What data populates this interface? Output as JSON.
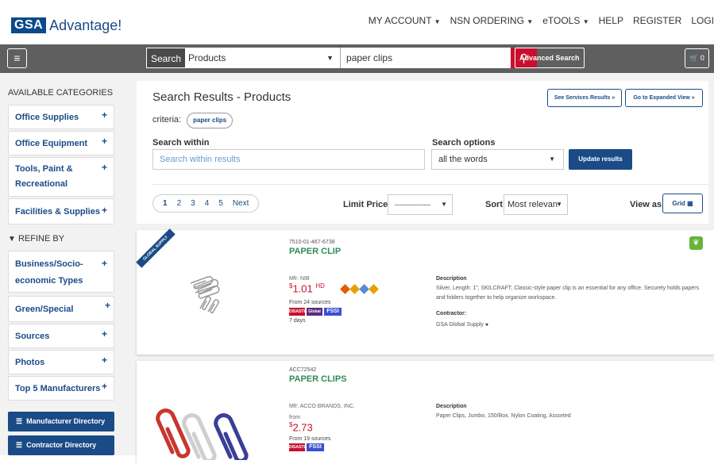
{
  "header": {
    "logo_gsa": "GSA",
    "logo_text": "Advantage!",
    "nav": [
      "MY ACCOUNT",
      "NSN ORDERING",
      "eTOOLS",
      "HELP",
      "REGISTER",
      "LOGI"
    ]
  },
  "search": {
    "label": "Search",
    "category": "Products",
    "query": "paper clips",
    "advanced": "Advanced Search",
    "cart_count": "0"
  },
  "sidebar": {
    "categories_header": "AVAILABLE CATEGORIES",
    "categories": [
      "Office Supplies",
      "Office Equipment",
      "Tools, Paint &",
      "Recreational",
      "Facilities & Supplies"
    ],
    "refine_header": "REFINE BY",
    "refine": [
      "Business/Socio-",
      "economic Types",
      "Green/Special Programs",
      "Sources",
      "Photos",
      "Top 5 Manufacturers"
    ],
    "dir_buttons": [
      "Manufacturer Directory",
      "Contractor Directory"
    ]
  },
  "results": {
    "title": "Search Results - Products",
    "services_btn": "See Services Results »",
    "expanded_btn": "Go to Expanded View »",
    "criteria_label": "criteria:",
    "criteria_chip": "paper clips",
    "search_within_label": "Search within",
    "search_within_placeholder": "Search within results",
    "search_options_label": "Search options",
    "search_options_value": "all the words",
    "update_btn": "Update results",
    "pages": [
      "1",
      "2",
      "3",
      "4",
      "5",
      "Next"
    ],
    "limit_price_label": "Limit Price",
    "limit_price_value": "---------------",
    "sort_label": "Sort",
    "sort_value": "Most relevan",
    "view_as_label": "View as",
    "view_btn": "Grid"
  },
  "products": [
    {
      "ribbon": "GLOBAL SUPPLY",
      "id": "7510-01-467-6738",
      "name": "PAPER CLIP",
      "mfr": "Mfr: NIB",
      "price": "1.01",
      "price_unit": "HD",
      "sources": "From 24 sources",
      "days": "7 days",
      "badges": [
        "DISASTER PURCH",
        "Global Supply",
        "FSSI"
      ],
      "desc_label": "Description",
      "desc": "Silver, Length: 1\", SKILCRAFT, Classic-style paper clip is an essential for any office. Securely holds papers and folders together to help organize workspace.",
      "contractor_label": "Contractor:",
      "contractor": "GSA Global Supply"
    },
    {
      "id": "ACC72542",
      "name": "PAPER CLIPS",
      "mfr": "Mfr: ACCO BRANDS, INC.",
      "from": "from",
      "price": "2.73",
      "sources": "From 19 sources",
      "badges": [
        "DISASTER PURCH",
        "FSSI"
      ],
      "desc_label": "Description",
      "desc": "Paper Clips, Jumbo, 150/Box, Nylon Coating, Assorted"
    }
  ]
}
